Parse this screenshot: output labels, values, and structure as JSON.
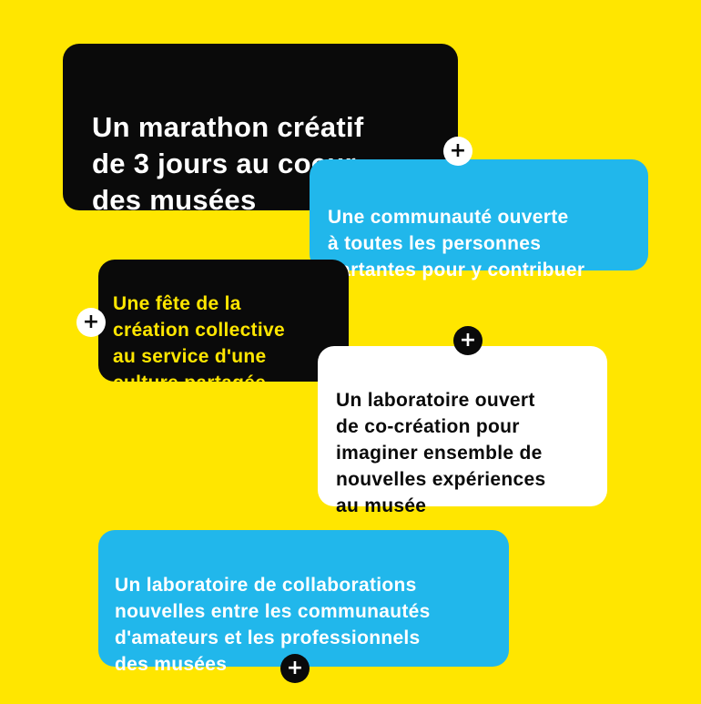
{
  "cards": [
    {
      "text": "Un marathon créatif\nde 3 jours au coeur\ndes musées",
      "color": "#0a0a0a"
    },
    {
      "text": "Une communauté ouverte\nà toutes les personnes\npartantes pour y contribuer",
      "color": "#21b7eb"
    },
    {
      "text": "Une fête de la\ncréation collective\nau service d'une\nculture partagée",
      "color": "#0a0a0a"
    },
    {
      "text": "Un laboratoire ouvert\nde co-création pour\nimaginer ensemble de\nnouvelles expériences\nau musée",
      "color": "#ffffff"
    },
    {
      "text": "Un laboratoire de collaborations\nnouvelles entre les communautés\nd'amateurs et les professionnels\ndes musées",
      "color": "#21b7eb"
    }
  ],
  "plus_symbol": "+",
  "colors": {
    "background": "#ffe600",
    "black": "#0a0a0a",
    "blue": "#21b7eb",
    "white": "#ffffff",
    "yellow_text": "#ffe600"
  },
  "icons": [
    "plus-icon"
  ]
}
